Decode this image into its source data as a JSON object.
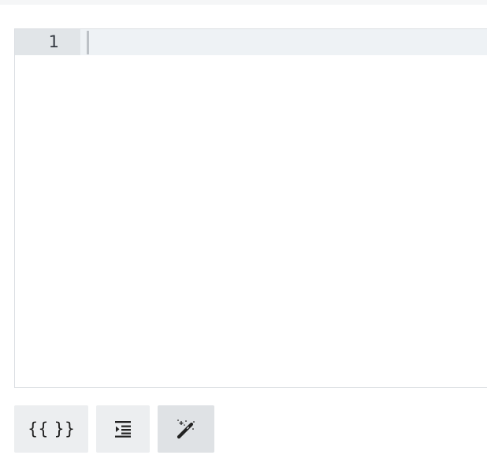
{
  "editor": {
    "line_numbers": [
      "1"
    ],
    "content": ""
  },
  "toolbar": {
    "buttons": [
      {
        "id": "template",
        "label": "{{ }}",
        "icon": "template-braces-icon"
      },
      {
        "id": "indent",
        "label": "",
        "icon": "indent-icon"
      },
      {
        "id": "format",
        "label": "",
        "icon": "magic-wand-icon",
        "active": true
      }
    ]
  },
  "colors": {
    "gutter": "#e1e5e8",
    "active_line": "#eef2f5",
    "button_bg": "#eceef0",
    "button_active_bg": "#dfe2e5"
  }
}
